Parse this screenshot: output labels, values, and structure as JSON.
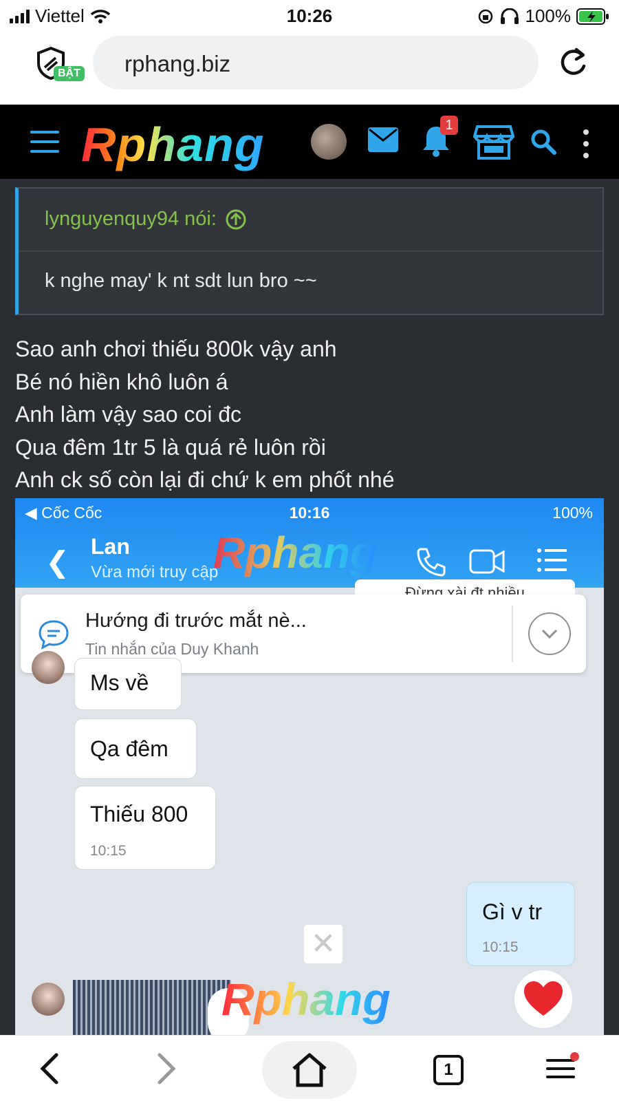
{
  "status_bar": {
    "carrier": "Viettel",
    "time": "10:26",
    "battery": "100%"
  },
  "browser": {
    "url": "rphang.biz",
    "shield_badge": "BẬT"
  },
  "site": {
    "logo": "Rphang",
    "notification_count": "1"
  },
  "quote": {
    "author": "lynguyenquy94 nói:",
    "text": "k nghe may' k nt sdt lun bro ~~"
  },
  "post_lines": [
    "Sao anh chơi thiếu 800k vậy anh",
    "Bé nó hiền khô luôn á",
    "Anh làm vậy sao coi đc",
    "Qua đêm 1tr 5 là quá rẻ luôn rồi",
    "Anh ck số còn lại đi chứ k em phốt nhé"
  ],
  "screenshot": {
    "status": {
      "left": "◀ Cốc Cốc",
      "time": "10:16",
      "battery": "100%"
    },
    "contact_name": "Lan",
    "contact_status": "Vừa mới truy cập",
    "watermark": "Rphang",
    "behind_text": "Đừng xài đt nhiều",
    "pinned": {
      "title": "Hướng đi trước mắt nè...",
      "subtitle": "Tin nhắn của Duy Khanh"
    },
    "messages": [
      {
        "text": "Ms về",
        "time": ""
      },
      {
        "text": "Qa đêm",
        "time": ""
      },
      {
        "text": "Thiếu 800",
        "time": "10:15"
      },
      {
        "text": "Gì v tr",
        "time": "10:15"
      }
    ],
    "close_glyph": "✕"
  },
  "bottom_nav": {
    "tab_count": "1"
  },
  "colors": {
    "accent": "#2fa6e9",
    "quote_author": "#84c34a",
    "page_bg": "#2a2d31",
    "badge_red": "#e23c3c"
  }
}
